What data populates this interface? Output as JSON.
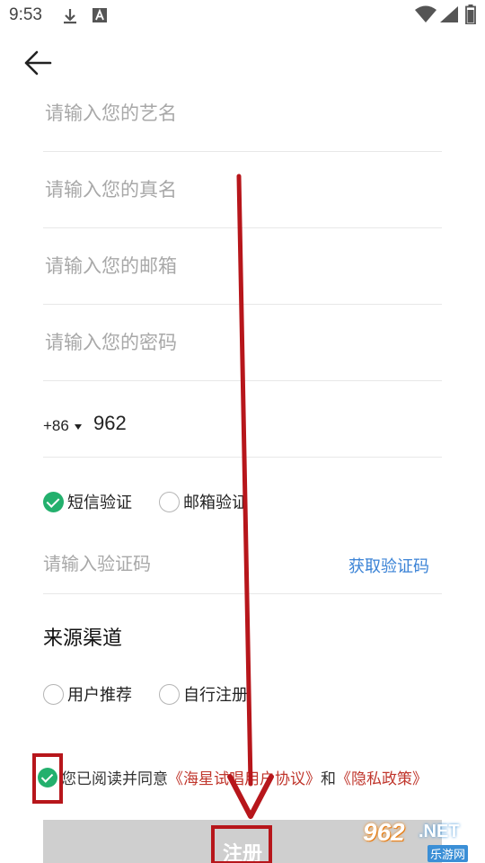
{
  "status_bar": {
    "time": "9:53",
    "icons": [
      "download-icon",
      "font-icon",
      "wifi-icon",
      "signal-icon",
      "battery-icon"
    ]
  },
  "form": {
    "stage_name_placeholder": "请输入您的艺名",
    "real_name_placeholder": "请输入您的真名",
    "email_placeholder": "请输入您的邮箱",
    "password_placeholder": "请输入您的密码",
    "country_code": "+86",
    "phone_value": "962",
    "verify_options": [
      {
        "label": "短信验证",
        "checked": true
      },
      {
        "label": "邮箱验证",
        "checked": false
      }
    ],
    "code_placeholder": "请输入验证码",
    "get_code_label": "获取验证码",
    "source_title": "来源渠道",
    "source_options": [
      {
        "label": "用户推荐",
        "checked": false
      },
      {
        "label": "自行注册",
        "checked": false
      }
    ],
    "agree_text": "您已阅读并同意",
    "agreement_link": "《海星试唱用户协议》",
    "and_text": "和",
    "privacy_link": "《隐私政策》",
    "register_label": "注册"
  },
  "watermark": {
    "number": "962",
    "suffix": ".NET",
    "name": "乐游网"
  },
  "colors": {
    "accent_green": "#23b06d",
    "link_blue": "#3b83d6",
    "link_red": "#c0362c",
    "annotation_red": "#b7161b",
    "button_gray": "#cfcfcf"
  }
}
